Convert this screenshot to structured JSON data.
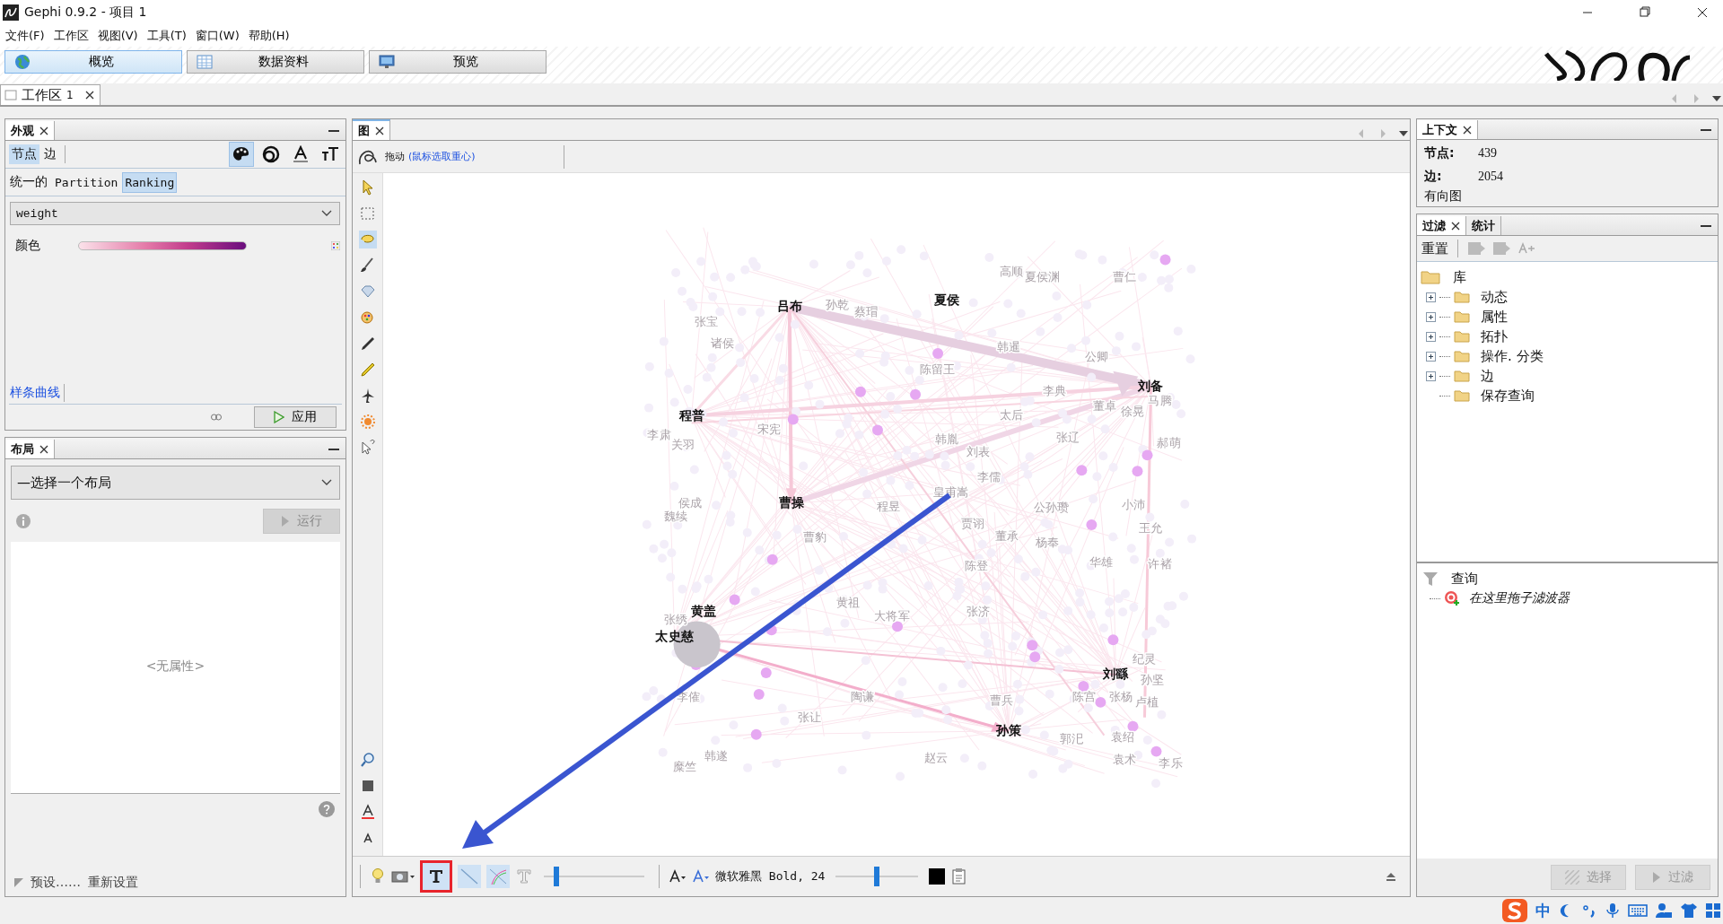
{
  "window": {
    "title": "Gephi 0.9.2 - 项目 1"
  },
  "menu": [
    "文件(F)",
    "工作区",
    "视图(V)",
    "工具(T)",
    "窗口(W)",
    "帮助(H)"
  ],
  "perspectives": [
    {
      "label": "概览",
      "kind": "globe",
      "selected": true
    },
    {
      "label": "数据资料",
      "kind": "table",
      "selected": false
    },
    {
      "label": "预览",
      "kind": "monitor",
      "selected": false
    }
  ],
  "workspace_tabs": [
    {
      "label": "工作区",
      "number": "1",
      "selected": true
    }
  ],
  "appearance": {
    "title": "外观",
    "element_tabs": [
      {
        "label": "节点",
        "selected": true
      },
      {
        "label": "边",
        "selected": false
      }
    ],
    "tools": [
      {
        "kind": "palette",
        "selected": true
      },
      {
        "kind": "size",
        "selected": false
      },
      {
        "kind": "label-color",
        "selected": false
      },
      {
        "kind": "label-size",
        "selected": false
      }
    ],
    "mode_tabs": [
      {
        "label": "统一的",
        "selected": false
      },
      {
        "label": "Partition",
        "selected": false
      },
      {
        "label": "Ranking",
        "selected": true
      }
    ],
    "attribute": "weight",
    "color_label": "颜色",
    "spline_link": "样条曲线",
    "apply_button": "应用"
  },
  "layout": {
    "title": "布局",
    "select": "—选择一个布局",
    "run_button": "运行",
    "empty_text": "<无属性>",
    "presets": "预设……",
    "reset": "重新设置"
  },
  "graph": {
    "tab": "图",
    "drag_label": "拖动",
    "drag_hint": "(鼠标选取重心)",
    "labels": [
      {
        "text": "吕布",
        "kind": "major"
      },
      {
        "text": "夏侯",
        "kind": "major"
      },
      {
        "text": "刘备",
        "kind": "major"
      },
      {
        "text": "程普",
        "kind": "major"
      },
      {
        "text": "曹操",
        "kind": "major"
      },
      {
        "text": "黄盖",
        "kind": "major"
      },
      {
        "text": "太史慈",
        "kind": "major"
      },
      {
        "text": "刘繇",
        "kind": "major"
      },
      {
        "text": "孙策",
        "kind": "major"
      },
      {
        "text": "张宝",
        "kind": "minor"
      },
      {
        "text": "诸侯",
        "kind": "minor"
      },
      {
        "text": "孙乾",
        "kind": "minor"
      },
      {
        "text": "蔡瑁",
        "kind": "minor"
      },
      {
        "text": "陈留王",
        "kind": "minor"
      },
      {
        "text": "韩暹",
        "kind": "minor"
      },
      {
        "text": "公卿",
        "kind": "minor"
      },
      {
        "text": "高顺",
        "kind": "minor"
      },
      {
        "text": "夏侯渊",
        "kind": "minor"
      },
      {
        "text": "曹仁",
        "kind": "minor"
      },
      {
        "text": "李典",
        "kind": "minor"
      },
      {
        "text": "董卓",
        "kind": "minor"
      },
      {
        "text": "徐晃",
        "kind": "minor"
      },
      {
        "text": "马腾",
        "kind": "minor"
      },
      {
        "text": "太后",
        "kind": "minor"
      },
      {
        "text": "宋宪",
        "kind": "minor"
      },
      {
        "text": "李肃",
        "kind": "minor"
      },
      {
        "text": "关羽",
        "kind": "minor"
      },
      {
        "text": "韩胤",
        "kind": "minor"
      },
      {
        "text": "张辽",
        "kind": "minor"
      },
      {
        "text": "刘表",
        "kind": "minor"
      },
      {
        "text": "郝萌",
        "kind": "minor"
      },
      {
        "text": "李儒",
        "kind": "minor"
      },
      {
        "text": "皇甫嵩",
        "kind": "minor"
      },
      {
        "text": "侯成",
        "kind": "minor"
      },
      {
        "text": "魏续",
        "kind": "minor"
      },
      {
        "text": "程昱",
        "kind": "minor"
      },
      {
        "text": "公孙瓒",
        "kind": "minor"
      },
      {
        "text": "小沛",
        "kind": "minor"
      },
      {
        "text": "贾诩",
        "kind": "minor"
      },
      {
        "text": "王允",
        "kind": "minor"
      },
      {
        "text": "曹豹",
        "kind": "minor"
      },
      {
        "text": "董承",
        "kind": "minor"
      },
      {
        "text": "杨奉",
        "kind": "minor"
      },
      {
        "text": "陈登",
        "kind": "minor"
      },
      {
        "text": "华雄",
        "kind": "minor"
      },
      {
        "text": "许褚",
        "kind": "minor"
      },
      {
        "text": "黄祖",
        "kind": "minor"
      },
      {
        "text": "大将军",
        "kind": "minor"
      },
      {
        "text": "张济",
        "kind": "minor"
      },
      {
        "text": "张绣",
        "kind": "minor"
      },
      {
        "text": "纪灵",
        "kind": "minor"
      },
      {
        "text": "孙坚",
        "kind": "minor"
      },
      {
        "text": "李傕",
        "kind": "minor"
      },
      {
        "text": "陶谦",
        "kind": "minor"
      },
      {
        "text": "曹兵",
        "kind": "minor"
      },
      {
        "text": "陈宫",
        "kind": "minor"
      },
      {
        "text": "张杨",
        "kind": "minor"
      },
      {
        "text": "卢植",
        "kind": "minor"
      },
      {
        "text": "张让",
        "kind": "minor"
      },
      {
        "text": "郭汜",
        "kind": "minor"
      },
      {
        "text": "袁绍",
        "kind": "minor"
      },
      {
        "text": "韩遂",
        "kind": "minor"
      },
      {
        "text": "糜竺",
        "kind": "minor"
      },
      {
        "text": "赵云",
        "kind": "minor"
      },
      {
        "text": "袁术",
        "kind": "minor"
      },
      {
        "text": "李乐",
        "kind": "minor"
      }
    ],
    "text_tool_highlighted": true,
    "label_size": {
      "level": 0.1
    },
    "font": "微软雅黑 Bold, 24",
    "label_scale": {
      "level": 0.5
    }
  },
  "context": {
    "title": "上下文",
    "rows": [
      {
        "label": "节点:",
        "value": "439"
      },
      {
        "label": "边:",
        "value": "2054"
      }
    ],
    "graph_type": "有向图"
  },
  "filters": {
    "tabs": [
      {
        "label": "过滤",
        "selected": true
      },
      {
        "label": "统计",
        "selected": false
      }
    ],
    "reset": "重置",
    "library": {
      "label": "库",
      "children": [
        {
          "label": "动态",
          "expanded": false
        },
        {
          "label": "属性",
          "expanded": false
        },
        {
          "label": "拓扑",
          "expanded": false
        },
        {
          "label": "操作. 分类",
          "expanded": false
        },
        {
          "label": "边",
          "expanded": false
        },
        {
          "label": "保存查询"
        }
      ]
    },
    "queries": {
      "label": "查询",
      "children": [
        {
          "label": "在这里拖子滤波器"
        }
      ]
    },
    "select_button": "选择",
    "filter_button": "过滤"
  },
  "tray": {
    "ime_mode": "中"
  }
}
